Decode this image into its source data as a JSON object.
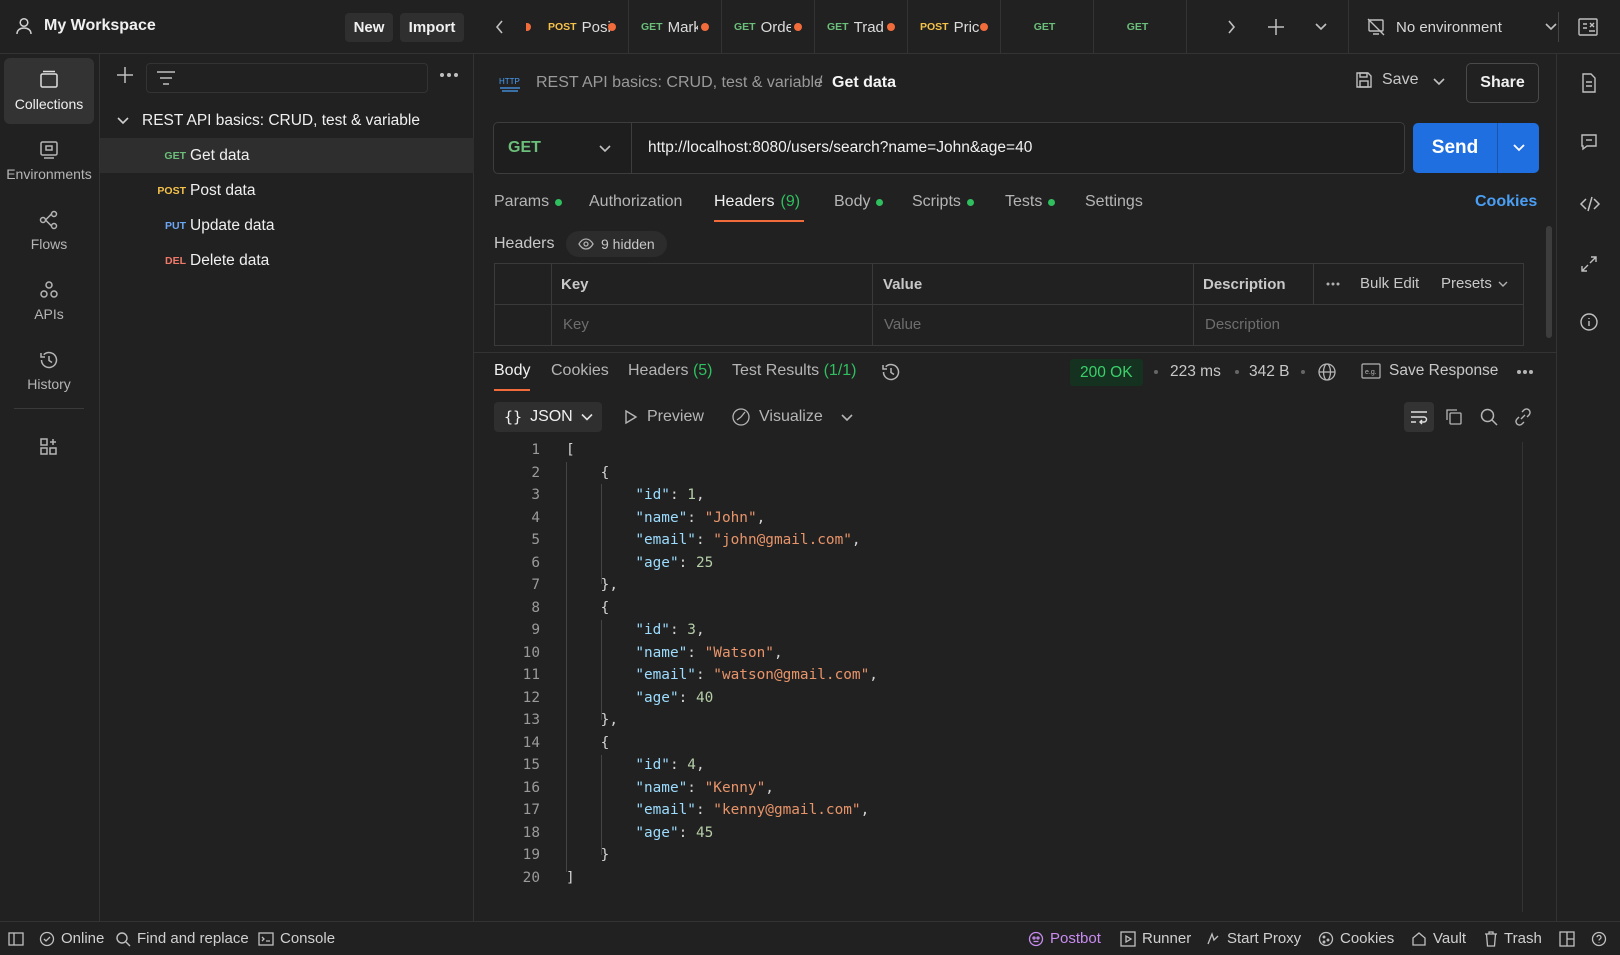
{
  "workspace": {
    "name": "My Workspace",
    "new_label": "New",
    "import_label": "Import"
  },
  "rail": {
    "items": [
      {
        "label": "Collections",
        "icon": "collections-icon",
        "active": true
      },
      {
        "label": "Environments",
        "icon": "environments-icon"
      },
      {
        "label": "Flows",
        "icon": "flows-icon"
      },
      {
        "label": "APIs",
        "icon": "apis-icon"
      },
      {
        "label": "History",
        "icon": "history-icon"
      }
    ]
  },
  "sidebar": {
    "collection_name": "REST API basics: CRUD, test & variable",
    "requests": [
      {
        "method": "GET",
        "name": "Get data",
        "selected": true
      },
      {
        "method": "POST",
        "name": "Post data"
      },
      {
        "method": "PUT",
        "name": "Update data"
      },
      {
        "method": "DEL",
        "name": "Delete data"
      }
    ]
  },
  "tabs": [
    {
      "method": "POST",
      "label": "Posi"
    },
    {
      "method": "GET",
      "label": "Mark"
    },
    {
      "method": "GET",
      "label": "Orde"
    },
    {
      "method": "GET",
      "label": "Trade"
    },
    {
      "method": "POST",
      "label": "Pric"
    },
    {
      "method": "GET",
      "label": ""
    },
    {
      "method": "GET",
      "label": ""
    }
  ],
  "environment": {
    "label": "No environment"
  },
  "request": {
    "breadcrumb_collection": "REST API basics: CRUD, test & variable",
    "breadcrumb_separator": "/",
    "breadcrumb_request": "Get data",
    "save_label": "Save",
    "share_label": "Share",
    "method": "GET",
    "url": "http://localhost:8080/users/search?name=John&age=40",
    "send_label": "Send",
    "tabs": {
      "params": "Params",
      "authorization": "Authorization",
      "headers": "Headers",
      "headers_count": "(9)",
      "body": "Body",
      "scripts": "Scripts",
      "tests": "Tests",
      "settings": "Settings"
    },
    "cookies_label": "Cookies",
    "headers_title": "Headers",
    "hidden_label": "9 hidden",
    "table": {
      "key_col": "Key",
      "value_col": "Value",
      "desc_col": "Description",
      "bulk_edit": "Bulk Edit",
      "presets": "Presets",
      "key_placeholder": "Key",
      "value_placeholder": "Value",
      "desc_placeholder": "Description"
    }
  },
  "response": {
    "tabs": {
      "body": "Body",
      "cookies": "Cookies",
      "headers": "Headers",
      "headers_count": "(5)",
      "test_results": "Test Results",
      "test_count": "(1/1)"
    },
    "status": "200 OK",
    "time": "223 ms",
    "size": "342 B",
    "save_response": "Save Response",
    "format": "JSON",
    "preview": "Preview",
    "visualize": "Visualize",
    "lines": [
      [
        [
          "p",
          "["
        ]
      ],
      [
        [
          "p",
          "    {"
        ]
      ],
      [
        [
          "p",
          "        "
        ],
        [
          "k",
          "\"id\""
        ],
        [
          "p",
          ": "
        ],
        [
          "n",
          "1"
        ],
        [
          "p",
          ","
        ]
      ],
      [
        [
          "p",
          "        "
        ],
        [
          "k",
          "\"name\""
        ],
        [
          "p",
          ": "
        ],
        [
          "s",
          "\"John\""
        ],
        [
          "p",
          ","
        ]
      ],
      [
        [
          "p",
          "        "
        ],
        [
          "k",
          "\"email\""
        ],
        [
          "p",
          ": "
        ],
        [
          "s",
          "\"john@gmail.com\""
        ],
        [
          "p",
          ","
        ]
      ],
      [
        [
          "p",
          "        "
        ],
        [
          "k",
          "\"age\""
        ],
        [
          "p",
          ": "
        ],
        [
          "n",
          "25"
        ]
      ],
      [
        [
          "p",
          "    },"
        ]
      ],
      [
        [
          "p",
          "    {"
        ]
      ],
      [
        [
          "p",
          "        "
        ],
        [
          "k",
          "\"id\""
        ],
        [
          "p",
          ": "
        ],
        [
          "n",
          "3"
        ],
        [
          "p",
          ","
        ]
      ],
      [
        [
          "p",
          "        "
        ],
        [
          "k",
          "\"name\""
        ],
        [
          "p",
          ": "
        ],
        [
          "s",
          "\"Watson\""
        ],
        [
          "p",
          ","
        ]
      ],
      [
        [
          "p",
          "        "
        ],
        [
          "k",
          "\"email\""
        ],
        [
          "p",
          ": "
        ],
        [
          "s",
          "\"watson@gmail.com\""
        ],
        [
          "p",
          ","
        ]
      ],
      [
        [
          "p",
          "        "
        ],
        [
          "k",
          "\"age\""
        ],
        [
          "p",
          ": "
        ],
        [
          "n",
          "40"
        ]
      ],
      [
        [
          "p",
          "    },"
        ]
      ],
      [
        [
          "p",
          "    {"
        ]
      ],
      [
        [
          "p",
          "        "
        ],
        [
          "k",
          "\"id\""
        ],
        [
          "p",
          ": "
        ],
        [
          "n",
          "4"
        ],
        [
          "p",
          ","
        ]
      ],
      [
        [
          "p",
          "        "
        ],
        [
          "k",
          "\"name\""
        ],
        [
          "p",
          ": "
        ],
        [
          "s",
          "\"Kenny\""
        ],
        [
          "p",
          ","
        ]
      ],
      [
        [
          "p",
          "        "
        ],
        [
          "k",
          "\"email\""
        ],
        [
          "p",
          ": "
        ],
        [
          "s",
          "\"kenny@gmail.com\""
        ],
        [
          "p",
          ","
        ]
      ],
      [
        [
          "p",
          "        "
        ],
        [
          "k",
          "\"age\""
        ],
        [
          "p",
          ": "
        ],
        [
          "n",
          "45"
        ]
      ],
      [
        [
          "p",
          "    }"
        ]
      ],
      [
        [
          "p",
          "]"
        ]
      ]
    ]
  },
  "statusbar": {
    "online": "Online",
    "find_replace": "Find and replace",
    "console": "Console",
    "postbot": "Postbot",
    "runner": "Runner",
    "start_proxy": "Start Proxy",
    "cookies": "Cookies",
    "vault": "Vault",
    "trash": "Trash"
  },
  "colors": {
    "send": "#1f6fe0",
    "link": "#4a9ff5",
    "ok": "#2fbf5f",
    "postbot": "#c88cf0"
  }
}
